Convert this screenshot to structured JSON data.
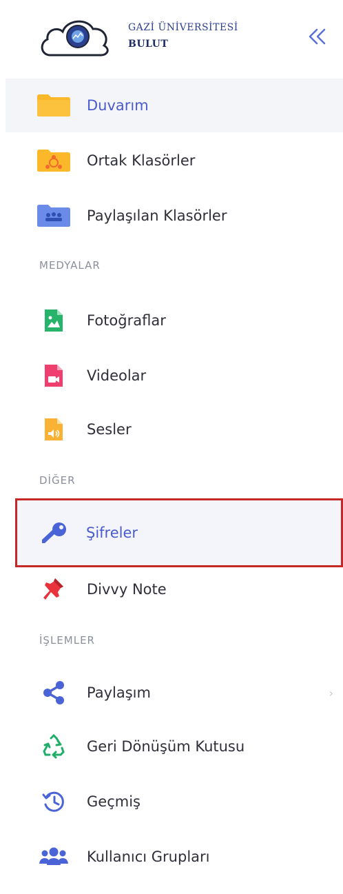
{
  "brand": {
    "line1": "GAZİ ÜNİVERSİTESİ",
    "line2": "BULUT"
  },
  "sections": {
    "medya": "MEDYALAR",
    "diger": "DİĞER",
    "islemler": "İŞLEMLER"
  },
  "items": {
    "duvarim": {
      "label": "Duvarım",
      "icon": "folder-icon"
    },
    "ortak": {
      "label": "Ortak Klasörler",
      "icon": "shared-folder-icon"
    },
    "paylasilan": {
      "label": "Paylaşılan Klasörler",
      "icon": "group-folder-icon"
    },
    "foto": {
      "label": "Fotoğraflar",
      "icon": "image-file-icon"
    },
    "video": {
      "label": "Videolar",
      "icon": "video-file-icon"
    },
    "ses": {
      "label": "Sesler",
      "icon": "audio-file-icon"
    },
    "sifreler": {
      "label": "Şifreler",
      "icon": "key-icon"
    },
    "divvy": {
      "label": "Divvy Note",
      "icon": "pin-icon"
    },
    "paylasim": {
      "label": "Paylaşım",
      "icon": "share-icon"
    },
    "geri": {
      "label": "Geri Dönüşüm Kutusu",
      "icon": "recycle-icon"
    },
    "gecmis": {
      "label": "Geçmiş",
      "icon": "history-icon"
    },
    "gruplar": {
      "label": "Kullanıcı Grupları",
      "icon": "users-icon"
    }
  },
  "colors": {
    "accent": "#4a5bcf",
    "highlight_border": "#c62828",
    "section": "#8b8f9c"
  }
}
